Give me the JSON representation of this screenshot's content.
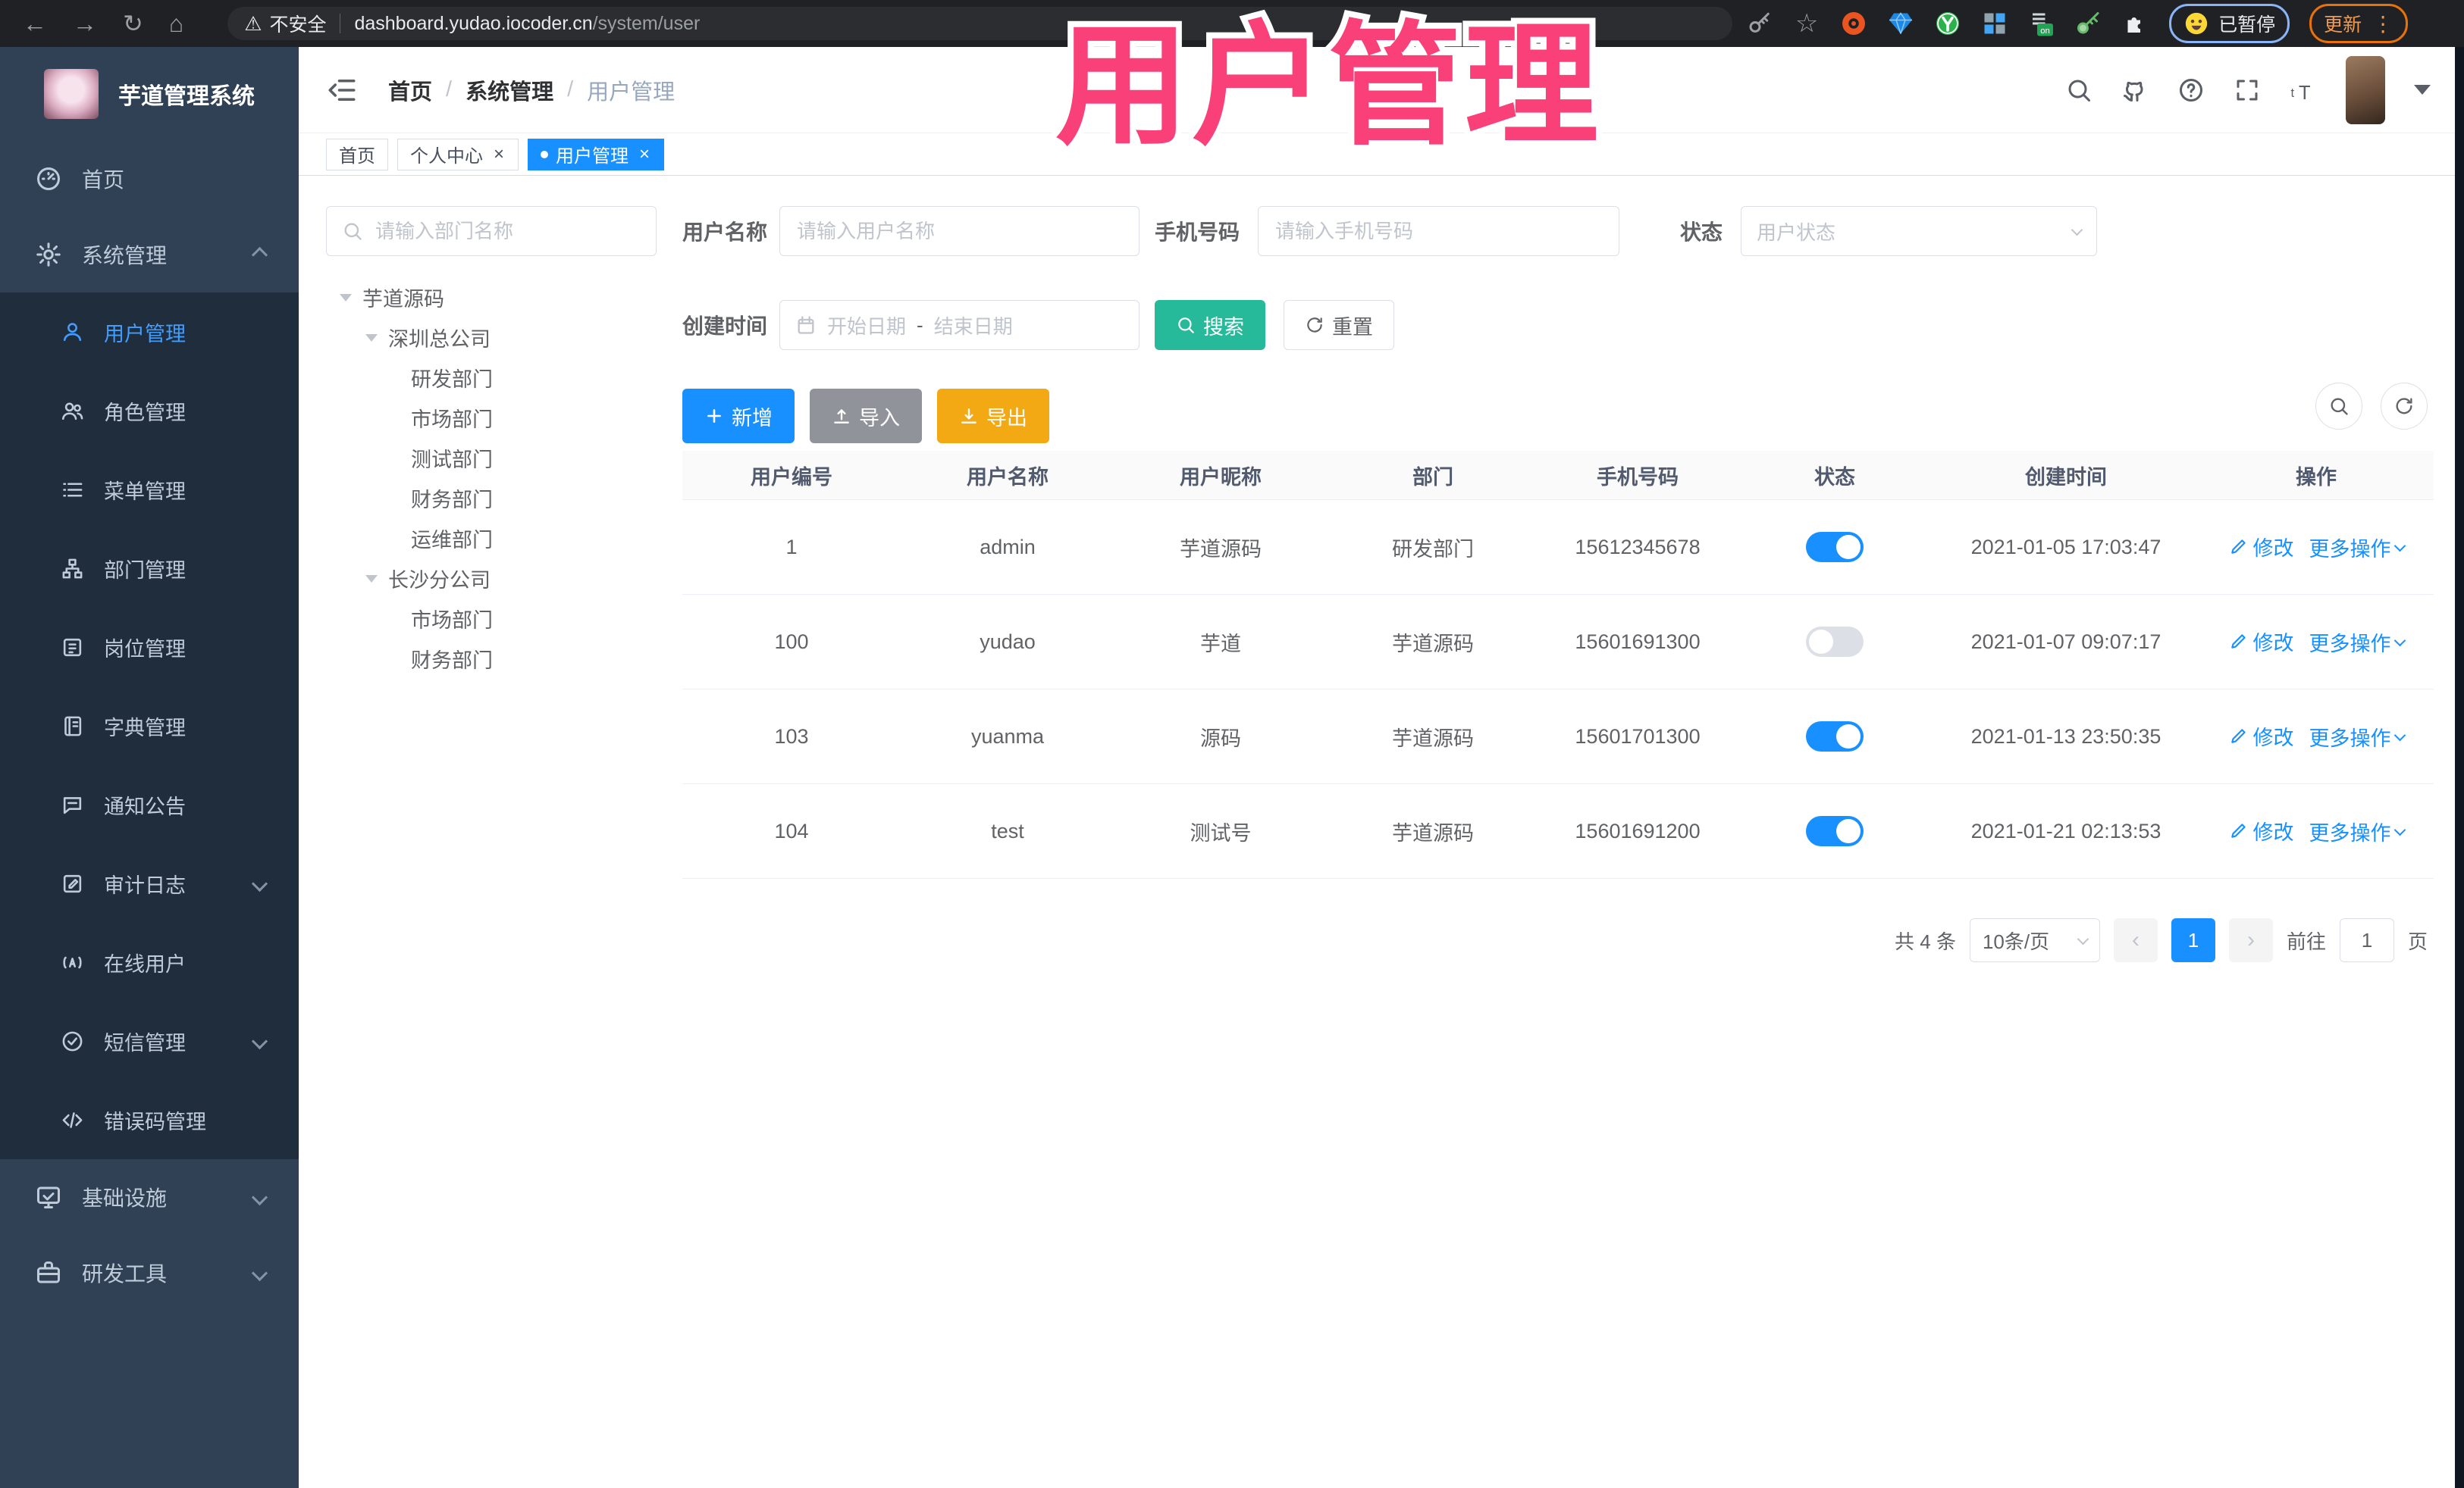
{
  "browser": {
    "security_label": "不安全",
    "url_host": "dashboard.yudao.iocoder.cn",
    "url_path": "/system/user",
    "paused_badge": "已暂停",
    "update_button": "更新",
    "left_icons": [
      "back",
      "forward",
      "refresh",
      "home"
    ],
    "right_icons": [
      "key",
      "star",
      "ubuntu",
      "gem",
      "yuque",
      "grid",
      "switch-on",
      "green-key",
      "puzzle"
    ]
  },
  "overlay_title": "用户管理",
  "sidebar": {
    "logo_title": "芋道管理系统",
    "items": [
      {
        "label": "首页",
        "icon": "dashboard",
        "type": "top"
      },
      {
        "label": "系统管理",
        "icon": "gear",
        "type": "top",
        "chevron": "up"
      },
      {
        "label": "用户管理",
        "icon": "user",
        "type": "sub",
        "active": true
      },
      {
        "label": "角色管理",
        "icon": "users",
        "type": "sub"
      },
      {
        "label": "菜单管理",
        "icon": "list",
        "type": "sub"
      },
      {
        "label": "部门管理",
        "icon": "tree",
        "type": "sub"
      },
      {
        "label": "岗位管理",
        "icon": "badge",
        "type": "sub"
      },
      {
        "label": "字典管理",
        "icon": "book",
        "type": "sub"
      },
      {
        "label": "通知公告",
        "icon": "chat",
        "type": "sub"
      },
      {
        "label": "审计日志",
        "icon": "edit",
        "type": "sub",
        "chevron": "down"
      },
      {
        "label": "在线用户",
        "icon": "online",
        "type": "sub"
      },
      {
        "label": "短信管理",
        "icon": "sms",
        "type": "sub",
        "chevron": "down"
      },
      {
        "label": "错误码管理",
        "icon": "code",
        "type": "sub"
      },
      {
        "label": "基础设施",
        "icon": "monitor",
        "type": "top",
        "chevron": "down"
      },
      {
        "label": "研发工具",
        "icon": "toolbox",
        "type": "top",
        "chevron": "down"
      }
    ]
  },
  "navbar": {
    "breadcrumb": [
      "首页",
      "系统管理",
      "用户管理"
    ],
    "breadcrumb_separator": "/",
    "icons": [
      "search",
      "github",
      "question",
      "fullscreen",
      "font-size"
    ]
  },
  "tabs": [
    {
      "label": "首页"
    },
    {
      "label": "个人中心",
      "closable": true
    },
    {
      "label": "用户管理",
      "closable": true,
      "active": true
    }
  ],
  "dept_panel": {
    "search_placeholder": "请输入部门名称",
    "tree": [
      {
        "label": "芋道源码",
        "level": 1,
        "arrow": true
      },
      {
        "label": "深圳总公司",
        "level": 2,
        "arrow": true
      },
      {
        "label": "研发部门",
        "level": 3
      },
      {
        "label": "市场部门",
        "level": 3
      },
      {
        "label": "测试部门",
        "level": 3
      },
      {
        "label": "财务部门",
        "level": 3
      },
      {
        "label": "运维部门",
        "level": 3
      },
      {
        "label": "长沙分公司",
        "level": 2,
        "arrow": true
      },
      {
        "label": "市场部门",
        "level": 3
      },
      {
        "label": "财务部门",
        "level": 3
      }
    ]
  },
  "filters": {
    "username_label": "用户名称",
    "username_placeholder": "请输入用户名称",
    "mobile_label": "手机号码",
    "mobile_placeholder": "请输入手机号码",
    "status_label": "状态",
    "status_placeholder": "用户状态",
    "create_time_label": "创建时间",
    "date_start_placeholder": "开始日期",
    "date_separator": "-",
    "date_end_placeholder": "结束日期",
    "search_button": "搜索",
    "reset_button": "重置"
  },
  "toolbar": {
    "add_button": "新增",
    "import_button": "导入",
    "export_button": "导出"
  },
  "table": {
    "columns": [
      "用户编号",
      "用户名称",
      "用户昵称",
      "部门",
      "手机号码",
      "状态",
      "创建时间",
      "操作"
    ],
    "rows": [
      {
        "id": "1",
        "username": "admin",
        "nickname": "芋道源码",
        "dept": "研发部门",
        "mobile": "15612345678",
        "status": "on",
        "created": "2021-01-05 17:03:47"
      },
      {
        "id": "100",
        "username": "yudao",
        "nickname": "芋道",
        "dept": "芋道源码",
        "mobile": "15601691300",
        "status": "off",
        "created": "2021-01-07 09:07:17"
      },
      {
        "id": "103",
        "username": "yuanma",
        "nickname": "源码",
        "dept": "芋道源码",
        "mobile": "15601701300",
        "status": "on",
        "created": "2021-01-13 23:50:35"
      },
      {
        "id": "104",
        "username": "test",
        "nickname": "测试号",
        "dept": "芋道源码",
        "mobile": "15601691200",
        "status": "on",
        "created": "2021-01-21 02:13:53"
      }
    ],
    "row_actions": {
      "edit": "修改",
      "more": "更多操作"
    }
  },
  "pagination": {
    "total_text": "共 4 条",
    "page_size": "10条/页",
    "prev_icon": "‹",
    "current_page": "1",
    "next_icon": "›",
    "goto_label": "前往",
    "goto_value": "1",
    "goto_suffix": "页"
  },
  "colors": {
    "accent": "#1890ff",
    "sidebar_active": "#409eff",
    "search_teal": "#26b99a",
    "export_orange": "#f2a913",
    "import_gray": "#909399",
    "overlay_pink": "#fa4078",
    "sidebar_bg": "#304156",
    "submenu_bg": "#1f2d3d"
  }
}
